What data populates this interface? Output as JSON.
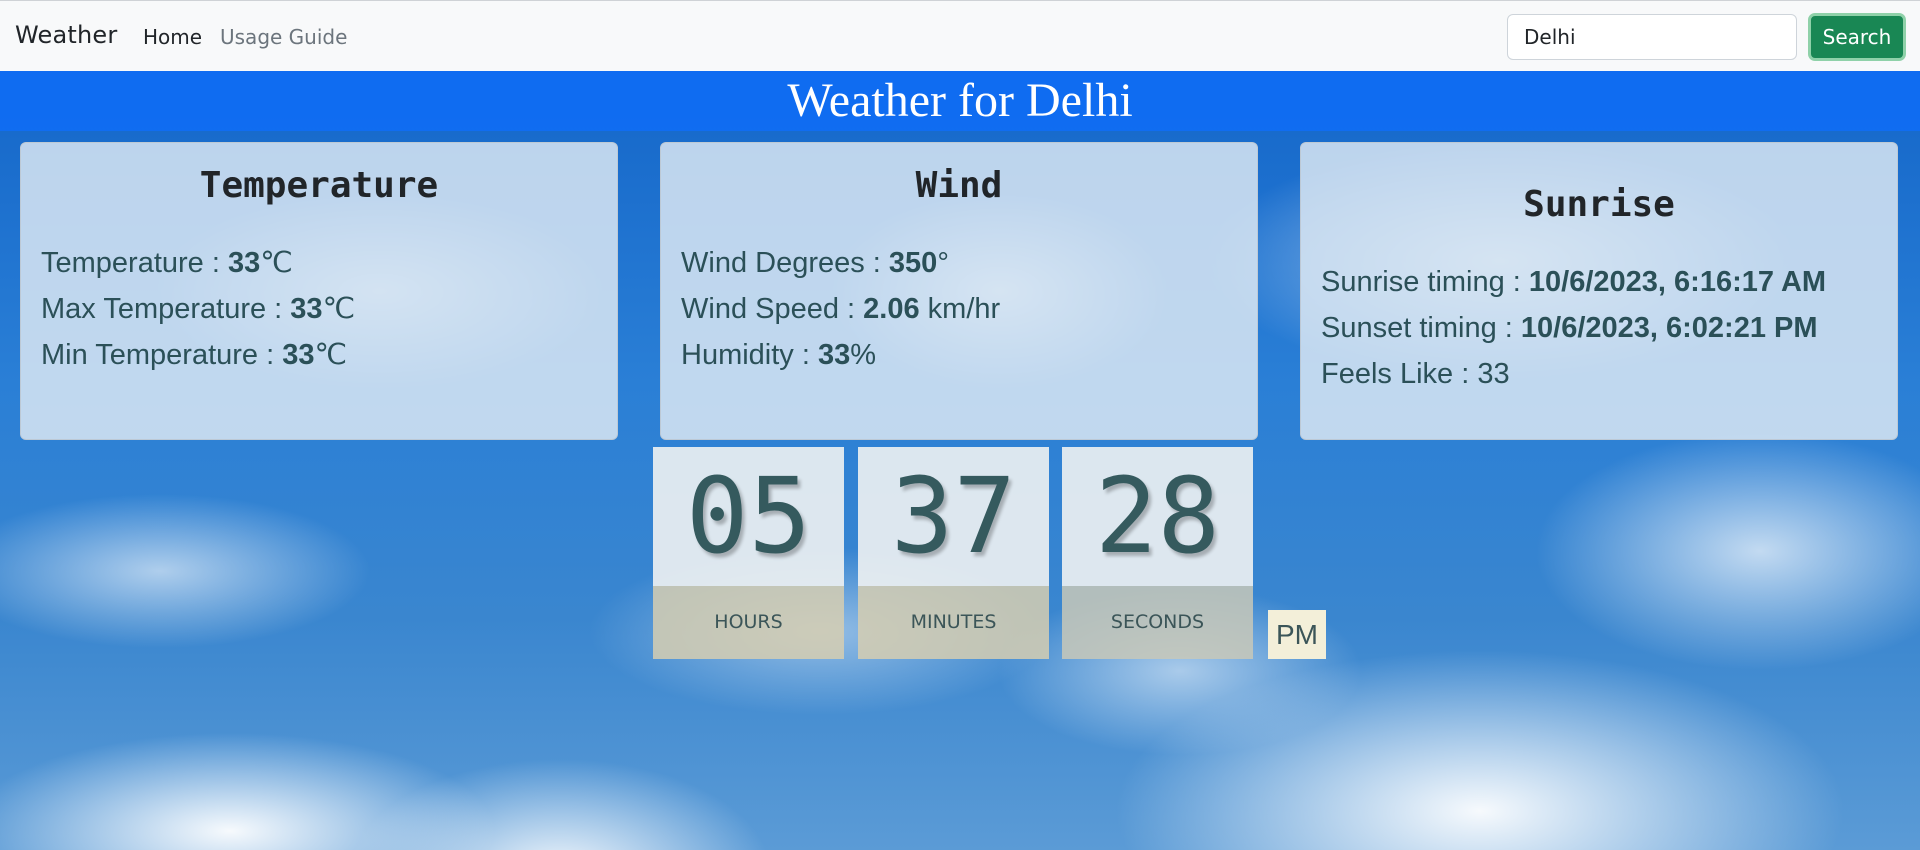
{
  "navbar": {
    "brand": "Weather",
    "links": [
      {
        "label": "Home"
      },
      {
        "label": "Usage Guide"
      }
    ],
    "search": {
      "value": "Delhi",
      "button_label": "Search"
    }
  },
  "page": {
    "title": "Weather for Delhi"
  },
  "cards": {
    "temperature": {
      "title": "Temperature",
      "rows": [
        {
          "label": "Temperature : ",
          "value": "33",
          "unit": "℃"
        },
        {
          "label": "Max Temperature : ",
          "value": "33",
          "unit": "℃"
        },
        {
          "label": "Min Temperature : ",
          "value": "33",
          "unit": "℃"
        }
      ]
    },
    "wind": {
      "title": "Wind",
      "rows": [
        {
          "label": "Wind Degrees : ",
          "value": "350",
          "unit": "°"
        },
        {
          "label": "Wind Speed : ",
          "value": "2.06",
          "unit": " km/hr"
        },
        {
          "label": "Humidity : ",
          "value": "33",
          "unit": "%"
        }
      ]
    },
    "sunrise": {
      "title": "Sunrise",
      "rows": [
        {
          "label": "Sunrise timing : ",
          "value": "10/6/2023, 6:16:17 AM"
        },
        {
          "label": "Sunset timing : ",
          "value": "10/6/2023, 6:02:21 PM"
        },
        {
          "label": "Feels Like : ",
          "value": "33"
        }
      ]
    }
  },
  "clock": {
    "hours": "05",
    "hours_label": "HOURS",
    "minutes": "37",
    "minutes_label": "MINUTES",
    "seconds": "28",
    "seconds_label": "SECONDS",
    "period": "PM"
  }
}
